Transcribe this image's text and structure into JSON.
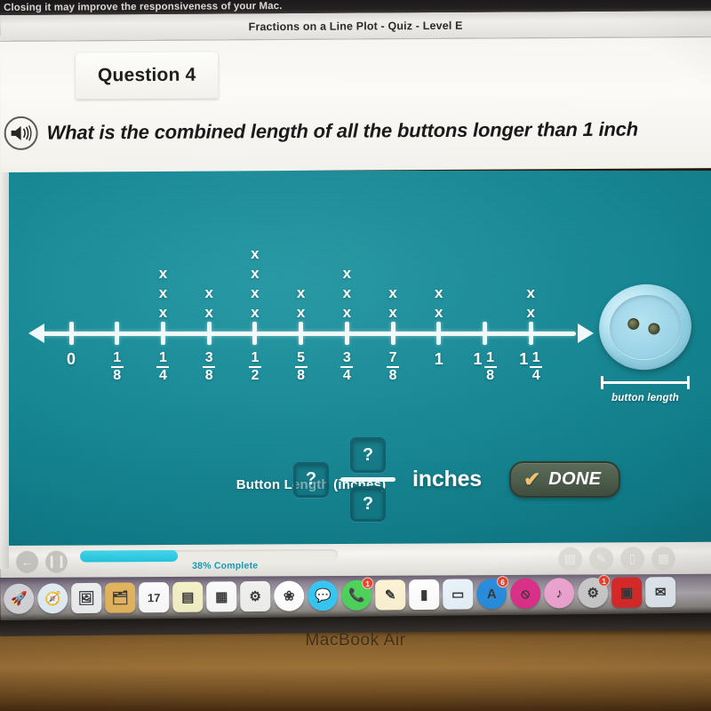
{
  "mac_notification": "Closing it may improve the responsiveness of your Mac.",
  "app": {
    "title": "Fractions on a Line Plot - Quiz - Level E"
  },
  "question": {
    "tab_label": "Question 4",
    "audio_icon": "speaker-icon",
    "prompt": "What is the combined length of all the buttons longer than 1 inch"
  },
  "chart_data": {
    "type": "line_plot",
    "title": "",
    "xlabel": "Button Length (inches)",
    "ylabel": "",
    "grid": false,
    "legend": "none",
    "marker": "x",
    "axis_arrows": "both",
    "categories": [
      "0",
      "1/8",
      "1/4",
      "3/8",
      "1/2",
      "5/8",
      "3/4",
      "7/8",
      "1",
      "1 1/8",
      "1 1/4"
    ],
    "tick_labels": [
      {
        "whole": "0",
        "num": "",
        "den": ""
      },
      {
        "whole": "",
        "num": "1",
        "den": "8"
      },
      {
        "whole": "",
        "num": "1",
        "den": "4"
      },
      {
        "whole": "",
        "num": "3",
        "den": "8"
      },
      {
        "whole": "",
        "num": "1",
        "den": "2"
      },
      {
        "whole": "",
        "num": "5",
        "den": "8"
      },
      {
        "whole": "",
        "num": "3",
        "den": "4"
      },
      {
        "whole": "",
        "num": "7",
        "den": "8"
      },
      {
        "whole": "1",
        "num": "",
        "den": ""
      },
      {
        "whole": "1",
        "num": "1",
        "den": "8"
      },
      {
        "whole": "1",
        "num": "1",
        "den": "4"
      }
    ],
    "values": [
      0,
      0,
      3,
      2,
      4,
      2,
      3,
      2,
      2,
      0,
      2
    ],
    "xlim": [
      0,
      1.25
    ],
    "ylim": [
      0,
      4
    ]
  },
  "illustration": {
    "name": "button-illustration",
    "caption": "button length",
    "hole_count": 2
  },
  "answer": {
    "whole_placeholder": "?",
    "numerator_placeholder": "?",
    "denominator_placeholder": "?",
    "unit_label": "inches",
    "done_label": "DONE",
    "done_check_glyph": "✔"
  },
  "controls": {
    "back_glyph": "←",
    "pause_glyph": "❙❙",
    "progress_percent": 38,
    "progress_text": "38% Complete",
    "tools": [
      {
        "name": "reference-tool-icon",
        "glyph": "▤"
      },
      {
        "name": "pencil-tool-icon",
        "glyph": "✎"
      },
      {
        "name": "notepad-tool-icon",
        "glyph": "▯"
      },
      {
        "name": "calculator-tool-icon",
        "glyph": "▦"
      }
    ]
  },
  "dock": {
    "items": [
      {
        "name": "launchpad",
        "glyph": "🚀",
        "bg": "#dcdde0",
        "badge": "",
        "round": true
      },
      {
        "name": "safari",
        "glyph": "🧭",
        "bg": "#e9f5fd",
        "badge": "",
        "round": true
      },
      {
        "name": "preview",
        "glyph": "🖼",
        "bg": "#f3f4f6",
        "badge": "",
        "round": false
      },
      {
        "name": "finder-folder",
        "glyph": "🗂",
        "bg": "#e8b860",
        "badge": "",
        "round": false
      },
      {
        "name": "calendar",
        "glyph": "17",
        "bg": "#ffffff",
        "badge": "",
        "round": false
      },
      {
        "name": "notes",
        "glyph": "▤",
        "bg": "#f6f2c8",
        "badge": "",
        "round": false
      },
      {
        "name": "reminders",
        "glyph": "▦",
        "bg": "#fbfbfb",
        "badge": "",
        "round": false
      },
      {
        "name": "utilities",
        "glyph": "⚙",
        "bg": "#f0f0ee",
        "badge": "",
        "round": false
      },
      {
        "name": "photos",
        "glyph": "❀",
        "bg": "#ffffff",
        "badge": "",
        "round": true
      },
      {
        "name": "messages",
        "glyph": "💬",
        "bg": "#37c7f2",
        "badge": "",
        "round": true
      },
      {
        "name": "facetime",
        "glyph": "📞",
        "bg": "#4ed35c",
        "badge": "1",
        "round": true
      },
      {
        "name": "pages",
        "glyph": "✎",
        "bg": "#fdf3d4",
        "badge": "",
        "round": false
      },
      {
        "name": "numbers",
        "glyph": "▮",
        "bg": "#ffffff",
        "badge": "",
        "round": false
      },
      {
        "name": "keynote",
        "glyph": "▭",
        "bg": "#eaf4fb",
        "badge": "",
        "round": false
      },
      {
        "name": "app-store",
        "glyph": "A",
        "bg": "#2a8fe0",
        "badge": "6",
        "round": true
      },
      {
        "name": "restricted",
        "glyph": "⦸",
        "bg": "#e0318c",
        "badge": "",
        "round": true
      },
      {
        "name": "itunes",
        "glyph": "♪",
        "bg": "#f3a7d5",
        "badge": "",
        "round": true
      },
      {
        "name": "system-preferences",
        "glyph": "⚙",
        "bg": "#cfcfcf",
        "badge": "1",
        "round": true
      },
      {
        "name": "roblox",
        "glyph": "▣",
        "bg": "#e02b2b",
        "badge": "",
        "round": false
      },
      {
        "name": "mail",
        "glyph": "✉",
        "bg": "#e9f0f8",
        "badge": "",
        "round": false
      }
    ]
  },
  "hardware": {
    "model_label": "MacBook Air"
  }
}
